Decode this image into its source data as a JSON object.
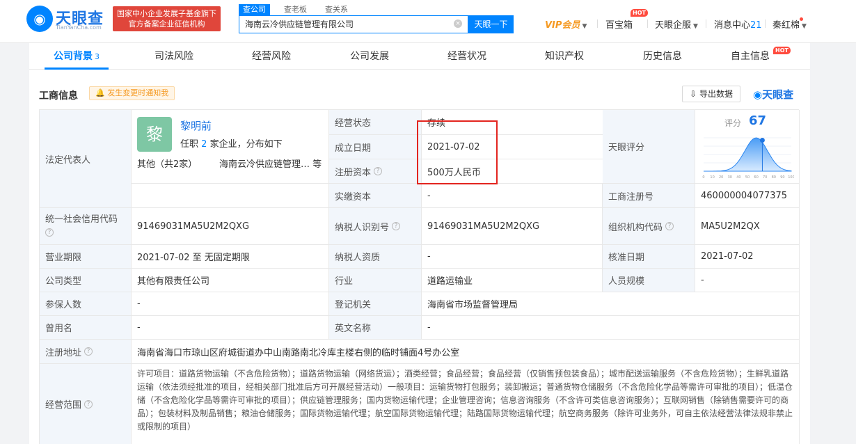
{
  "header": {
    "logo_text": "天眼查",
    "logo_sub": "TianYanCha.com",
    "badge_line1": "国家中小企业发展子基金旗下",
    "badge_line2": "官方备案企业征信机构",
    "search_tabs": [
      "查公司",
      "查老板",
      "查关系"
    ],
    "search_value": "海南云冷供应链管理有限公司",
    "search_button": "天眼一下",
    "vip": "VIP会员",
    "toolbox": "百宝箱",
    "enterprise": "天眼企服",
    "messages": "消息中心",
    "message_count": "21",
    "user": "秦红棉",
    "hot": "HOT"
  },
  "tabs": [
    {
      "label": "公司背景",
      "count": "3"
    },
    {
      "label": "司法风险",
      "count": ""
    },
    {
      "label": "经营风险",
      "count": ""
    },
    {
      "label": "公司发展",
      "count": ""
    },
    {
      "label": "经营状况",
      "count": ""
    },
    {
      "label": "知识产权",
      "count": ""
    },
    {
      "label": "历史信息",
      "count": ""
    },
    {
      "label": "自主信息",
      "count": ""
    }
  ],
  "section": {
    "title": "工商信息",
    "notify": "发生变更时通知我",
    "export": "导出数据",
    "brand": "天眼查"
  },
  "rep": {
    "label": "法定代表人",
    "avatar_char": "黎",
    "name": "黎明前",
    "sub_prefix": "任职",
    "sub_count": "2",
    "sub_suffix": "家企业，分布如下",
    "other": "其他（共2家）",
    "company": "海南云冷供应链管理…",
    "etc": "等"
  },
  "score": {
    "label": "天眼评分",
    "caption": "评分",
    "value": "67",
    "ticks": [
      "0",
      "10",
      "20",
      "30",
      "40",
      "50",
      "60",
      "70",
      "80",
      "90",
      "100"
    ],
    "color": "#1f76e3"
  },
  "fields": {
    "status_label": "经营状态",
    "status": "存续",
    "founded_label": "成立日期",
    "founded": "2021-07-02",
    "capital_label": "注册资本",
    "capital": "500万人民币",
    "paidin_label": "实缴资本",
    "paidin": "-",
    "regno_label": "工商注册号",
    "regno": "460000004077375",
    "credit_label": "统一社会信用代码",
    "credit": "91469031MA5U2M2QXG",
    "taxid_label": "纳税人识别号",
    "taxid": "91469031MA5U2M2QXG",
    "orgcode_label": "组织机构代码",
    "orgcode": "MA5U2M2QX",
    "term_label": "营业期限",
    "term": "2021-07-02 至 无固定期限",
    "taxqual_label": "纳税人资质",
    "taxqual": "-",
    "approve_label": "核准日期",
    "approve": "2021-07-02",
    "type_label": "公司类型",
    "type": "其他有限责任公司",
    "industry_label": "行业",
    "industry": "道路运输业",
    "staff_label": "人员规模",
    "staff": "-",
    "insured_label": "参保人数",
    "insured": "-",
    "authority_label": "登记机关",
    "authority": "海南省市场监督管理局",
    "former_label": "曾用名",
    "former": "-",
    "english_label": "英文名称",
    "english": "-",
    "address_label": "注册地址",
    "address": "海南省海口市琼山区府城街道办中山南路南北冷库主楼右侧的临时铺面4号办公室",
    "scope_label": "经营范围",
    "scope": "许可项目：道路货物运输（不含危险货物）；道路货物运输（网络货运）；酒类经营；食品经营；食品经营（仅销售预包装食品）；城市配送运输服务（不含危险货物）；生鲜乳道路运输（依法须经批准的项目，经相关部门批准后方可开展经营活动）一般项目：运输货物打包服务；装卸搬运；普通货物仓储服务（不含危险化学品等需许可审批的项目）；低温仓储（不含危险化学品等需许可审批的项目）；供应链管理服务；国内货物运输代理；企业管理咨询；信息咨询服务（不含许可类信息咨询服务）；互联网销售（除销售需要许可的商品）；包装材料及制品销售；粮油仓储服务；国际货物运输代理；航空国际货物运输代理；陆路国际货物运输代理；航空商务服务（除许可业务外，可自主依法经营法律法规非禁止或限制的项目）"
  },
  "colors": {
    "accent": "#0084ff",
    "highlight_box": "#e3251f",
    "label_bg": "#f2f6fb"
  }
}
